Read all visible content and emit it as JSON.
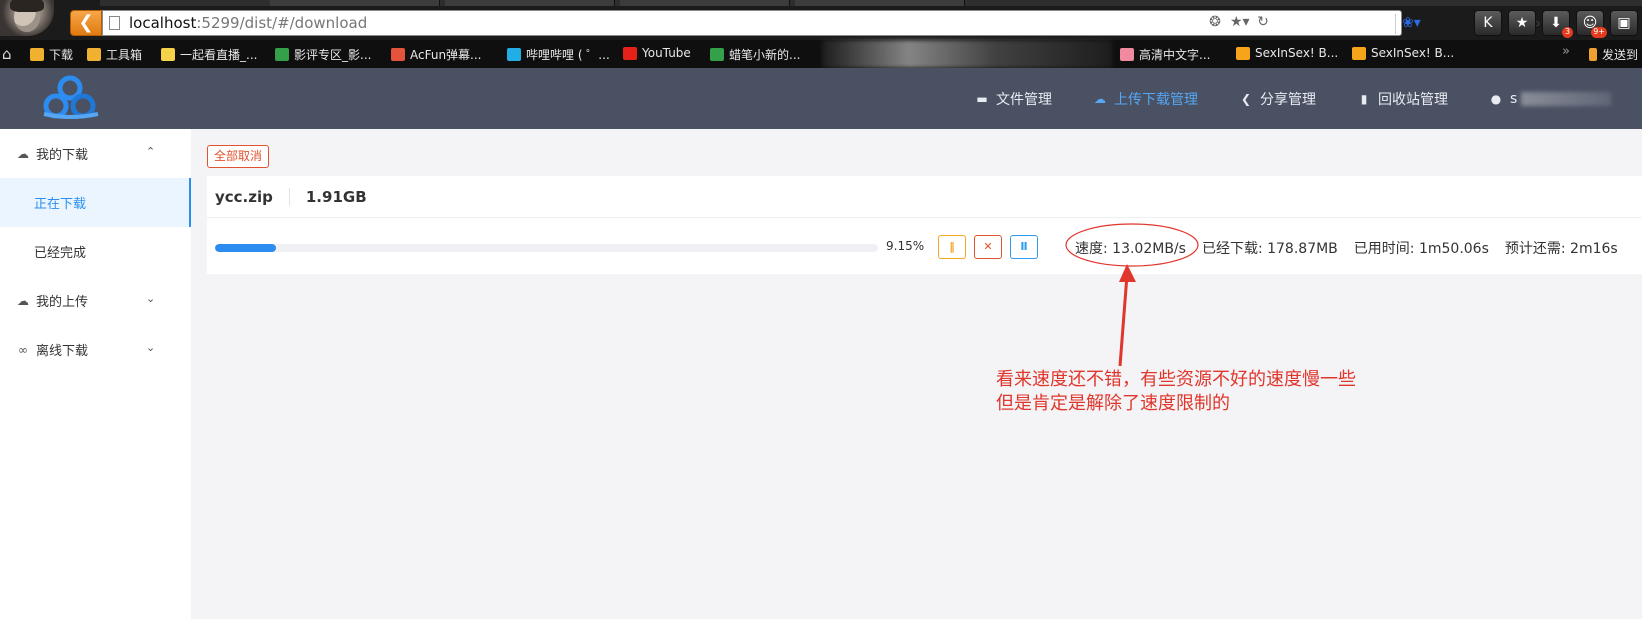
{
  "browser": {
    "url_host": "localhost",
    "url_rest": ":5299/dist/#/download",
    "extension_badges": [
      "3",
      "9+"
    ],
    "bookmarks": [
      {
        "label": "下载",
        "icon": "folder-icon",
        "color": "#f0b030"
      },
      {
        "label": "工具箱",
        "icon": "folder-icon",
        "color": "#f0b030"
      },
      {
        "label": "一起看直播_...",
        "icon": "leaf-icon",
        "color": "#f5d24a"
      },
      {
        "label": "影评专区_影...",
        "icon": "panda-icon",
        "color": "#35a04a"
      },
      {
        "label": "AcFun弹幕...",
        "icon": "acfun-icon",
        "color": "#e5533a"
      },
      {
        "label": "哔哩哔哩 ( ゜...",
        "icon": "bilibili-icon",
        "color": "#23ade5"
      },
      {
        "label": "YouTube",
        "icon": "youtube-icon",
        "color": "#e62117"
      },
      {
        "label": "蜡笔小新的...",
        "icon": "panda-icon",
        "color": "#35a04a"
      },
      {
        "label": "高清中文字...",
        "icon": "pig-icon",
        "color": "#f08aa0"
      },
      {
        "label": "SexInSex! B...",
        "icon": "sis-icon",
        "color": "#f6a51b"
      },
      {
        "label": "SexInSex! B...",
        "icon": "sis-icon",
        "color": "#f6a51b"
      },
      {
        "label": "发送到",
        "icon": "phone-icon",
        "color": "#f0a030"
      }
    ]
  },
  "header": {
    "nav": [
      {
        "label": "文件管理",
        "icon": "folder-icon",
        "active": false
      },
      {
        "label": "上传下载管理",
        "icon": "cloud-icon",
        "active": true
      },
      {
        "label": "分享管理",
        "icon": "share-icon",
        "active": false
      },
      {
        "label": "回收站管理",
        "icon": "trash-icon",
        "active": false
      }
    ],
    "user_initial": "s"
  },
  "sidebar": {
    "my_download": "我的下载",
    "downloading": "正在下载",
    "completed": "已经完成",
    "my_upload": "我的上传",
    "offline_download": "离线下载"
  },
  "main": {
    "cancel_all": "全部取消",
    "task": {
      "file_name": "ycc.zip",
      "file_size": "1.91GB",
      "progress_percent": 9.15,
      "progress_label": "9.15%",
      "speed": "速度: 13.02MB/s",
      "downloaded": "已经下载: 178.87MB",
      "elapsed": "已用时间: 1m50.06s",
      "remaining": "预计还需: 2m16s"
    }
  },
  "annotation": {
    "line1": "看来速度还不错，有些资源不好的速度慢一些",
    "line2": "但是肯定是解除了速度限制的",
    "color": "#e0362c"
  }
}
